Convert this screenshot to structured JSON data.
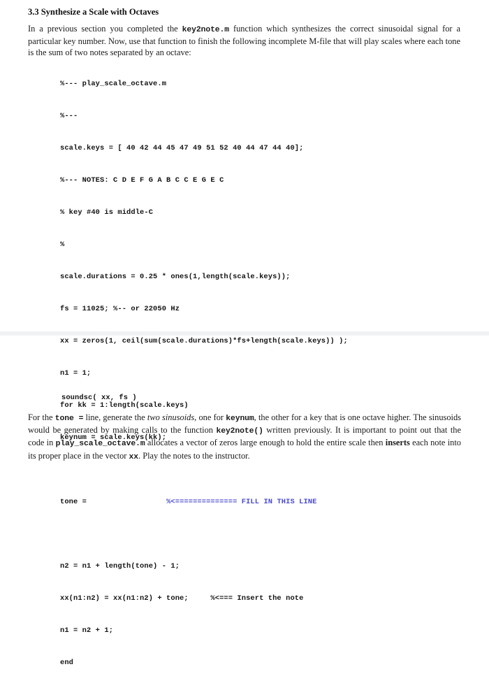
{
  "document": {
    "section_heading": "3.3 Synthesize a Scale with Octaves",
    "intro_paragraph": {
      "part1": "In a previous section you completed the ",
      "code1": "key2note.m",
      "part2": " function which synthesizes the correct sinusoidal signal for a particular key number. Now, use that function to finish the following incomplete M-file that will play scales where each tone is the sum of two notes separated by an octave:"
    },
    "code_lines": [
      "%--- play_scale_octave.m",
      "%---",
      "scale.keys = [ 40 42 44 45 47 49 51 52 40 44 47 44 40];",
      "%--- NOTES: C D E F G A B C C E G E C",
      "% key #40 is middle-C",
      "%",
      "scale.durations = 0.25 * ones(1,length(scale.keys));",
      "fs = 11025; %-- or 22050 Hz",
      "xx = zeros(1, ceil(sum(scale.durations)*fs+length(scale.keys)) );",
      "n1 = 1;",
      "for kk = 1:length(scale.keys)",
      "keynum = scale.keys(kk);"
    ],
    "fill_line": {
      "code": "tone =                  ",
      "marker": "%<============== FILL IN THIS LINE",
      "marker_color": "#4b4bcf"
    },
    "code_lines_after": [
      "n2 = n1 + length(tone) - 1;",
      "xx(n1:n2) = xx(n1:n2) + tone;     %<=== Insert the note",
      "n1 = n2 + 1;",
      "end"
    ],
    "code_tail": "soundsc( xx, fs )",
    "outro_paragraph": {
      "p1": "For the ",
      "c1": "tone =",
      "p2": " line, generate the ",
      "i1": "two sinusoids",
      "p3": ", one for ",
      "c2": "keynum",
      "p4": ", the other for a key that is one octave higher. The sinusoids would be generated by making calls to the function ",
      "c3": "key2note()",
      "p5": " written previously. It is important to point out that the code in ",
      "c4": "play_scale_octave.m",
      "p6": " allocates a vector of zeros large enough to hold the entire scale then ",
      "b1": "inserts",
      "p7": " each note into its proper place in the vector ",
      "c5": "xx",
      "p8": ". Play the notes to the instructor."
    },
    "separator_color": "#f1f2f4"
  }
}
